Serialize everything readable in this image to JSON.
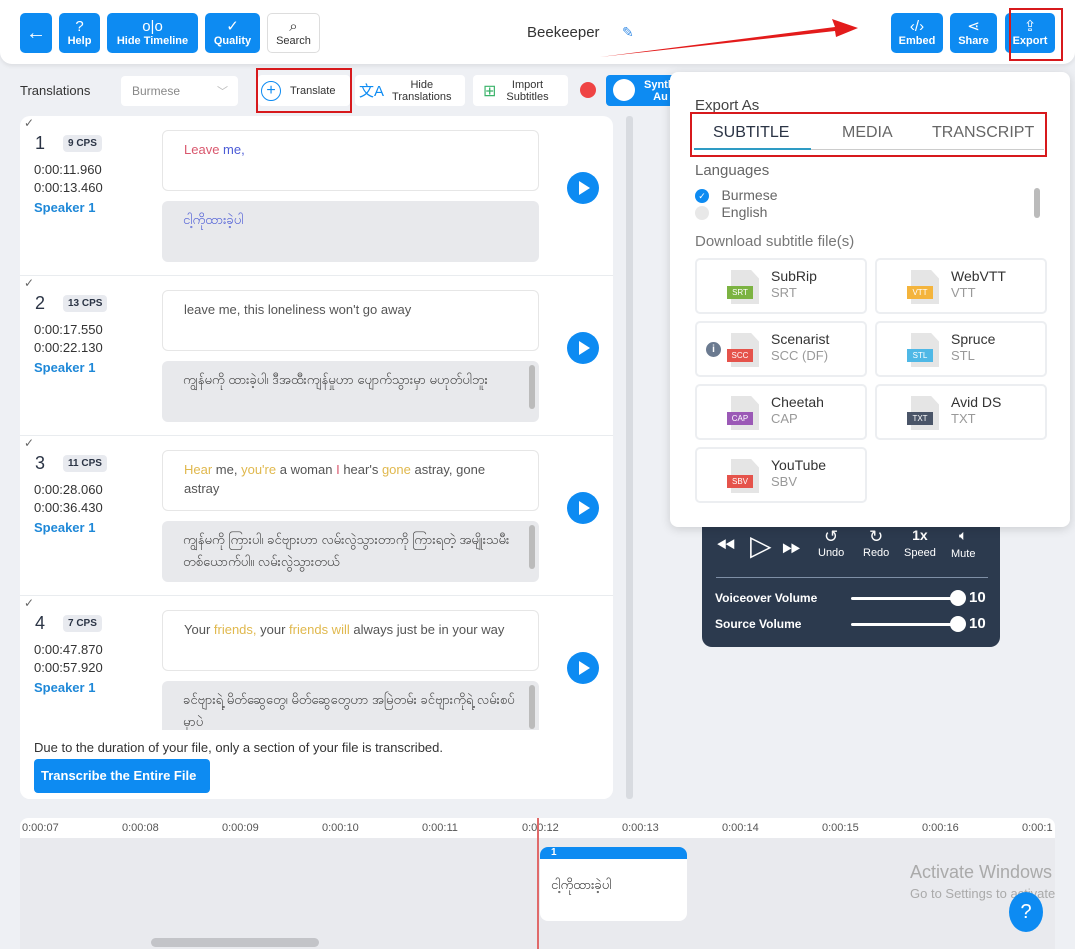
{
  "header": {
    "title": "Beekeeper",
    "buttons": {
      "back": "←",
      "help": "Help",
      "hide_timeline": "Hide Timeline",
      "quality": "Quality",
      "search": "Search",
      "embed": "Embed",
      "share": "Share",
      "export": "Export"
    }
  },
  "toolbar": {
    "translations_label": "Translations",
    "language_select": "Burmese",
    "translate": "Translate",
    "hide_translations": [
      "Hide",
      "Translations"
    ],
    "import_subtitles": [
      "Import",
      "Subtitles"
    ],
    "synthesize": [
      "Synth",
      "Au"
    ]
  },
  "segments": [
    {
      "num": "1",
      "cps": "9 CPS",
      "start": "0:00:11.960",
      "end": "0:00:13.460",
      "speaker": "Speaker 1",
      "source": [
        {
          "t": "Leave",
          "c": "red"
        },
        {
          "t": " me,",
          "c": "blue"
        }
      ],
      "translation": "ငါ့ကိုထားခဲ့ပါ",
      "translation_color": "blue"
    },
    {
      "num": "2",
      "cps": "13 CPS",
      "start": "0:00:17.550",
      "end": "0:00:22.130",
      "speaker": "Speaker 1",
      "source": [
        {
          "t": "leave me, this loneliness won't go away",
          "c": ""
        }
      ],
      "translation": "ကျွန်မကို ထားခဲ့ပါ၊ ဒီအထီးကျန်မှုဟာ ပျောက်သွားမှာ မဟုတ်ပါဘူး",
      "translation_color": ""
    },
    {
      "num": "3",
      "cps": "11 CPS",
      "start": "0:00:28.060",
      "end": "0:00:36.430",
      "speaker": "Speaker 1",
      "source": [
        {
          "t": "Hear",
          "c": "yel"
        },
        {
          "t": " me, ",
          "c": ""
        },
        {
          "t": "you're",
          "c": "yel"
        },
        {
          "t": " a woman ",
          "c": ""
        },
        {
          "t": "I",
          "c": "red"
        },
        {
          "t": " hear's ",
          "c": ""
        },
        {
          "t": "gone",
          "c": "yel"
        },
        {
          "t": " astray, gone astray",
          "c": ""
        }
      ],
      "translation": "ကျွန်မကို ကြားပါ၊ ခင်ဗျားဟာ လမ်းလွဲသွားတာကို ကြားရတဲ့ အမျိုးသမီးတစ်ယောက်ပါ။ လမ်းလွဲသွားတယ်",
      "translation_color": ""
    },
    {
      "num": "4",
      "cps": "7 CPS",
      "start": "0:00:47.870",
      "end": "0:00:57.920",
      "speaker": "Speaker 1",
      "source": [
        {
          "t": "Your ",
          "c": ""
        },
        {
          "t": "friends,",
          "c": "yel"
        },
        {
          "t": " your ",
          "c": ""
        },
        {
          "t": "friends will",
          "c": "yel"
        },
        {
          "t": " always just be in your way",
          "c": ""
        }
      ],
      "translation": "ခင်ဗျားရဲ့ မိတ်ဆွေတွေ၊ မိတ်ဆွေတွေဟာ အမြဲတမ်း ခင်ဗျားကိုရဲ့ လမ်းစပ်မှာပဲ",
      "translation_color": ""
    }
  ],
  "notice": {
    "text": "Due to the duration of your file, only a section of your file is transcribed.",
    "button": "Transcribe the Entire File"
  },
  "export": {
    "title": "Export As",
    "tabs": [
      "SUBTITLE",
      "MEDIA",
      "TRANSCRIPT"
    ],
    "active_tab": "SUBTITLE",
    "languages_label": "Languages",
    "languages": [
      {
        "name": "Burmese",
        "checked": true
      },
      {
        "name": "English",
        "checked": false
      }
    ],
    "download_label": "Download subtitle file(s)",
    "formats": [
      {
        "name": "SubRip",
        "ext": "SRT",
        "badge": "SRT",
        "color": "#7cb342"
      },
      {
        "name": "WebVTT",
        "ext": "VTT",
        "badge": "VTT",
        "color": "#f4b43c"
      },
      {
        "name": "Scenarist",
        "ext": "SCC (DF)",
        "badge": "SCC",
        "color": "#e5534b",
        "info": true
      },
      {
        "name": "Spruce",
        "ext": "STL",
        "badge": "STL",
        "color": "#4fb8e6"
      },
      {
        "name": "Cheetah",
        "ext": "CAP",
        "badge": "CAP",
        "color": "#9b59b6"
      },
      {
        "name": "Avid DS",
        "ext": "TXT",
        "badge": "TXT",
        "color": "#4a5568"
      },
      {
        "name": "YouTube",
        "ext": "SBV",
        "badge": "SBV",
        "color": "#e5534b"
      }
    ]
  },
  "player": {
    "controls": {
      "undo": "Undo",
      "redo": "Redo",
      "speed_value": "1x",
      "speed": "Speed",
      "mute": "Mute"
    },
    "voiceover_label": "Voiceover Volume",
    "voiceover_value": "10",
    "source_label": "Source Volume",
    "source_value": "10"
  },
  "timeline": {
    "ticks": [
      "0:00:07",
      "0:00:08",
      "0:00:09",
      "0:00:10",
      "0:00:11",
      "0:00:12",
      "0:00:13",
      "0:00:14",
      "0:00:15",
      "0:00:16",
      "0:00:1"
    ],
    "cue": {
      "num": "1",
      "text": "ငါ့ကိုထားခဲ့ပါ"
    }
  },
  "watermark": {
    "line1": "Activate Windows",
    "line2": "Go to Settings to activate"
  }
}
